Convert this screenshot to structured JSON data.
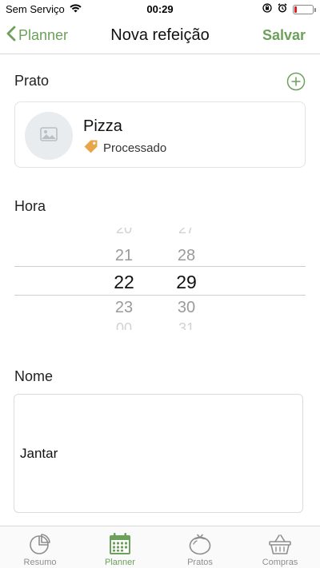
{
  "status_bar": {
    "carrier": "Sem Serviço",
    "time": "00:29"
  },
  "nav": {
    "back_label": "Planner",
    "title": "Nova refeição",
    "save_label": "Salvar"
  },
  "dish_section": {
    "label": "Prato",
    "dish": {
      "name": "Pizza",
      "category": "Processado"
    }
  },
  "time_section": {
    "label": "Hora",
    "hours": [
      "20",
      "21",
      "22",
      "23",
      "00"
    ],
    "minutes": [
      "27",
      "28",
      "29",
      "30",
      "31"
    ],
    "selected_hour": "22",
    "selected_minute": "29"
  },
  "name_section": {
    "label": "Nome",
    "value": "Jantar"
  },
  "tabs": [
    {
      "label": "Resumo",
      "icon": "pie-chart-icon",
      "active": false
    },
    {
      "label": "Planner",
      "icon": "calendar-icon",
      "active": true
    },
    {
      "label": "Pratos",
      "icon": "tomato-icon",
      "active": false
    },
    {
      "label": "Compras",
      "icon": "basket-icon",
      "active": false
    }
  ],
  "colors": {
    "accent": "#6ba15a",
    "tag": "#e8a64a",
    "battery_low": "#e02020"
  }
}
